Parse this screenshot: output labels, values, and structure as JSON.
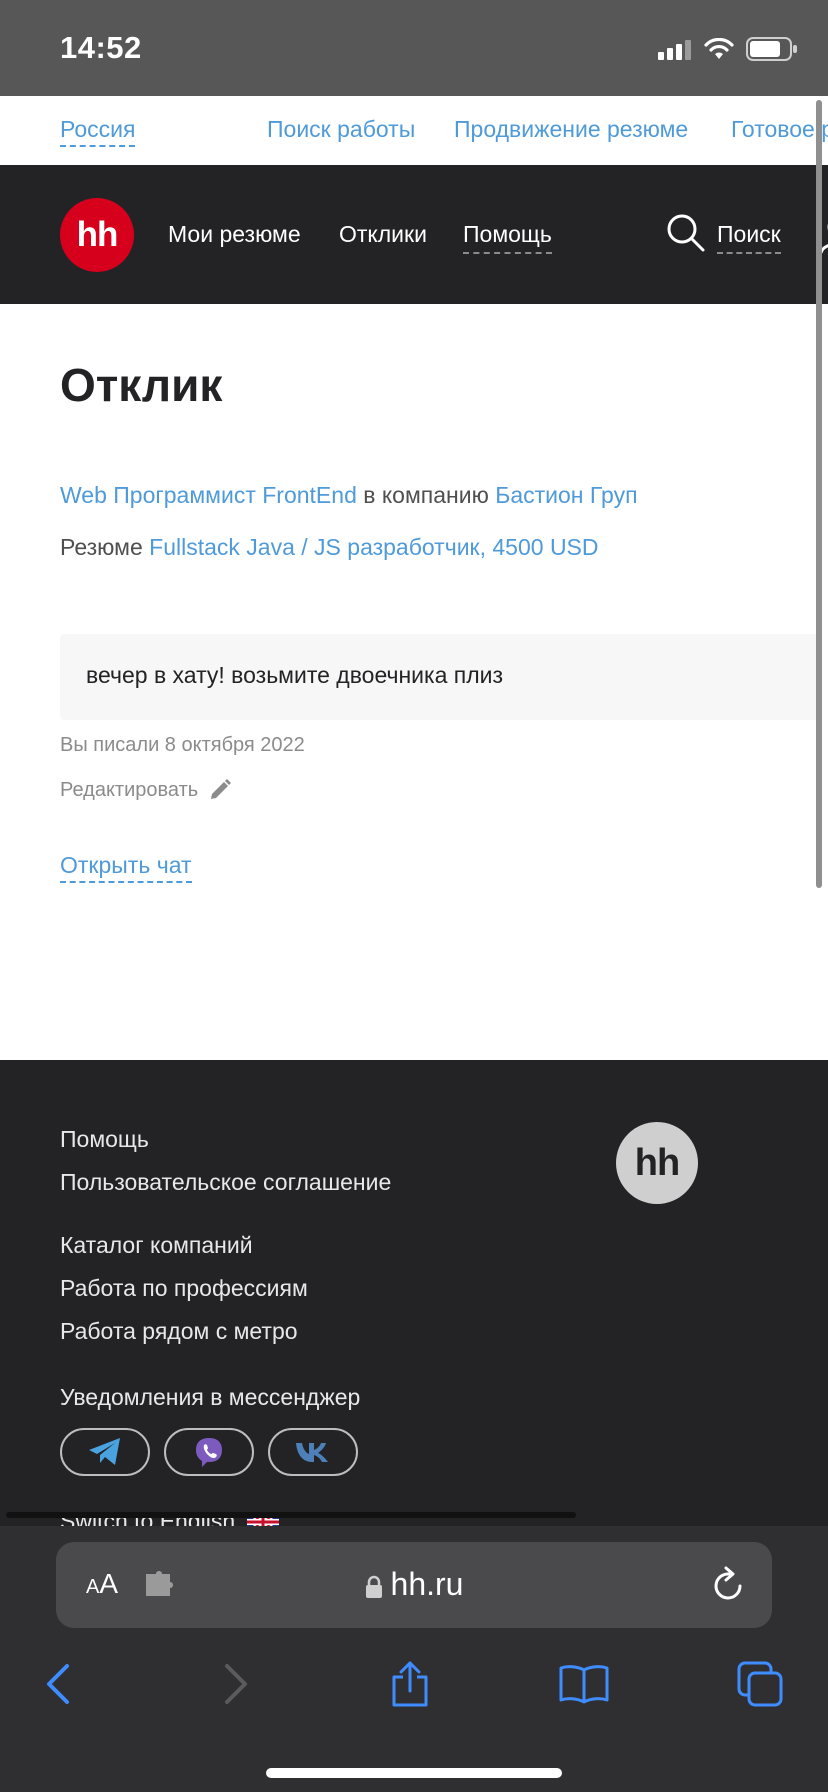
{
  "status_bar": {
    "time": "14:52"
  },
  "top_links": {
    "region": "Россия",
    "items": [
      "Поиск работы",
      "Продвижение резюме",
      "Готовое резюме"
    ]
  },
  "header": {
    "logo": "hh",
    "nav": [
      "Мои резюме",
      "Отклики",
      "Помощь"
    ],
    "search_label": "Поиск"
  },
  "main": {
    "title": "Отклик",
    "vacancy_link": "Web Программист FrontEnd",
    "in_company_text": " в компанию ",
    "company_link": "Бастион Груп",
    "resume_prefix": "Резюме ",
    "resume_link": "Fullstack Java / JS разработчик, 4500 USD",
    "message": "вечер в хату! возьмите двоечника плиз",
    "written_date": "Вы писали 8 октября 2022",
    "edit_label": "Редактировать",
    "open_chat": "Открыть чат"
  },
  "footer": {
    "links_group1": [
      "Помощь",
      "Пользовательское соглашение"
    ],
    "links_group2": [
      "Каталог компаний",
      "Работа по профессиям",
      "Работа рядом с метро"
    ],
    "messenger_heading": "Уведомления в мессенджер",
    "messengers": [
      "telegram-icon",
      "viber-icon",
      "vk-icon"
    ],
    "switch_language": "Switch to English",
    "logo": "hh"
  },
  "browser": {
    "text_size_label_small": "A",
    "text_size_label_large": "A",
    "url": "hh.ru"
  },
  "colors": {
    "link": "#4f9ad9",
    "header_bg": "#232325",
    "brand_red": "#d6001c"
  }
}
